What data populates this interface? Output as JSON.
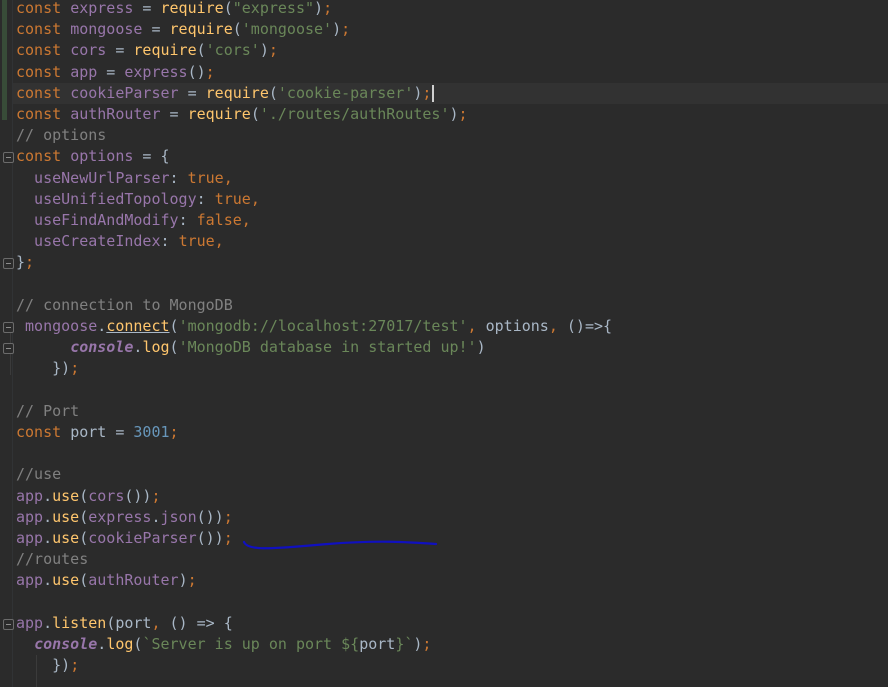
{
  "editor": {
    "lines": [
      [
        {
          "t": "const ",
          "c": "kw"
        },
        {
          "t": "express",
          "c": "id"
        },
        {
          "t": " = ",
          "c": "pl"
        },
        {
          "t": "require",
          "c": "fn"
        },
        {
          "t": "(",
          "c": "pl"
        },
        {
          "t": "\"express\"",
          "c": "str"
        },
        {
          "t": ")",
          "c": "pl"
        },
        {
          "t": ";",
          "c": "kw"
        }
      ],
      [
        {
          "t": "const ",
          "c": "kw"
        },
        {
          "t": "mongoose",
          "c": "id"
        },
        {
          "t": " = ",
          "c": "pl"
        },
        {
          "t": "require",
          "c": "fn"
        },
        {
          "t": "(",
          "c": "pl"
        },
        {
          "t": "'mongoose'",
          "c": "str"
        },
        {
          "t": ")",
          "c": "pl"
        },
        {
          "t": ";",
          "c": "kw"
        }
      ],
      [
        {
          "t": "const ",
          "c": "kw"
        },
        {
          "t": "cors",
          "c": "id"
        },
        {
          "t": " = ",
          "c": "pl"
        },
        {
          "t": "require",
          "c": "fn"
        },
        {
          "t": "(",
          "c": "pl"
        },
        {
          "t": "'cors'",
          "c": "str"
        },
        {
          "t": ")",
          "c": "pl"
        },
        {
          "t": ";",
          "c": "kw"
        }
      ],
      [
        {
          "t": "const ",
          "c": "kw"
        },
        {
          "t": "app",
          "c": "id"
        },
        {
          "t": " = ",
          "c": "pl"
        },
        {
          "t": "express",
          "c": "id"
        },
        {
          "t": "()",
          "c": "pl"
        },
        {
          "t": ";",
          "c": "kw"
        }
      ],
      [
        {
          "t": "const ",
          "c": "kw"
        },
        {
          "t": "cookieParser",
          "c": "id"
        },
        {
          "t": " = ",
          "c": "pl"
        },
        {
          "t": "require",
          "c": "fn"
        },
        {
          "t": "(",
          "c": "pl"
        },
        {
          "t": "'cookie-parser'",
          "c": "str"
        },
        {
          "t": ")",
          "c": "pl"
        },
        {
          "t": ";",
          "c": "kw"
        }
      ],
      [
        {
          "t": "const ",
          "c": "kw"
        },
        {
          "t": "authRouter",
          "c": "id"
        },
        {
          "t": " = ",
          "c": "pl"
        },
        {
          "t": "require",
          "c": "fn"
        },
        {
          "t": "(",
          "c": "pl"
        },
        {
          "t": "'./routes/authRoutes'",
          "c": "str"
        },
        {
          "t": ")",
          "c": "pl"
        },
        {
          "t": ";",
          "c": "kw"
        }
      ],
      [
        {
          "t": "// options",
          "c": "cm"
        }
      ],
      [
        {
          "t": "const ",
          "c": "kw"
        },
        {
          "t": "options",
          "c": "id"
        },
        {
          "t": " = {",
          "c": "pl"
        }
      ],
      [
        {
          "t": "  useNewUrlParser",
          "c": "id"
        },
        {
          "t": ": ",
          "c": "pl"
        },
        {
          "t": "true",
          "c": "kw"
        },
        {
          "t": ",",
          "c": "kw"
        }
      ],
      [
        {
          "t": "  useUnifiedTopology",
          "c": "id"
        },
        {
          "t": ": ",
          "c": "pl"
        },
        {
          "t": "true",
          "c": "kw"
        },
        {
          "t": ",",
          "c": "kw"
        }
      ],
      [
        {
          "t": "  useFindAndModify",
          "c": "id"
        },
        {
          "t": ": ",
          "c": "pl"
        },
        {
          "t": "false",
          "c": "kw"
        },
        {
          "t": ",",
          "c": "kw"
        }
      ],
      [
        {
          "t": "  useCreateIndex",
          "c": "id"
        },
        {
          "t": ": ",
          "c": "pl"
        },
        {
          "t": "true",
          "c": "kw"
        },
        {
          "t": ",",
          "c": "kw"
        }
      ],
      [
        {
          "t": "}",
          "c": "pl"
        },
        {
          "t": ";",
          "c": "kw"
        }
      ],
      [],
      [
        {
          "t": "// connection to MongoDB",
          "c": "cm"
        }
      ],
      [
        {
          "t": " mongoose",
          "c": "id"
        },
        {
          "t": ".",
          "c": "pl"
        },
        {
          "t": "connect",
          "c": "fn und"
        },
        {
          "t": "(",
          "c": "pl"
        },
        {
          "t": "'mongodb://localhost:27017/test'",
          "c": "str"
        },
        {
          "t": ", ",
          "c": "kw"
        },
        {
          "t": "options",
          "c": "pl"
        },
        {
          "t": ", ",
          "c": "kw"
        },
        {
          "t": "()=>{",
          "c": "pl"
        }
      ],
      [
        {
          "t": "      ",
          "c": "pl"
        },
        {
          "t": "console",
          "c": "gl"
        },
        {
          "t": ".",
          "c": "pl"
        },
        {
          "t": "log",
          "c": "fn"
        },
        {
          "t": "(",
          "c": "pl"
        },
        {
          "t": "'MongoDB database in started up!'",
          "c": "str"
        },
        {
          "t": ")",
          "c": "pl"
        }
      ],
      [
        {
          "t": "    })",
          "c": "pl"
        },
        {
          "t": ";",
          "c": "kw"
        }
      ],
      [],
      [
        {
          "t": "// Port",
          "c": "cm"
        }
      ],
      [
        {
          "t": "const ",
          "c": "kw"
        },
        {
          "t": "port",
          "c": "pl"
        },
        {
          "t": " = ",
          "c": "pl"
        },
        {
          "t": "3001",
          "c": "num"
        },
        {
          "t": ";",
          "c": "kw"
        }
      ],
      [],
      [
        {
          "t": "//use",
          "c": "cm"
        }
      ],
      [
        {
          "t": "app",
          "c": "id"
        },
        {
          "t": ".",
          "c": "pl"
        },
        {
          "t": "use",
          "c": "fn"
        },
        {
          "t": "(",
          "c": "pl"
        },
        {
          "t": "cors",
          "c": "id"
        },
        {
          "t": "())",
          "c": "pl"
        },
        {
          "t": ";",
          "c": "kw"
        }
      ],
      [
        {
          "t": "app",
          "c": "id"
        },
        {
          "t": ".",
          "c": "pl"
        },
        {
          "t": "use",
          "c": "fn"
        },
        {
          "t": "(",
          "c": "pl"
        },
        {
          "t": "express",
          "c": "id"
        },
        {
          "t": ".",
          "c": "pl"
        },
        {
          "t": "json",
          "c": "id"
        },
        {
          "t": "())",
          "c": "pl"
        },
        {
          "t": ";",
          "c": "kw"
        }
      ],
      [
        {
          "t": "app",
          "c": "id"
        },
        {
          "t": ".",
          "c": "pl"
        },
        {
          "t": "use",
          "c": "fn"
        },
        {
          "t": "(",
          "c": "pl"
        },
        {
          "t": "cookieParser",
          "c": "id"
        },
        {
          "t": "())",
          "c": "pl"
        },
        {
          "t": ";",
          "c": "kw"
        }
      ],
      [
        {
          "t": "//routes",
          "c": "cm"
        }
      ],
      [
        {
          "t": "app",
          "c": "id"
        },
        {
          "t": ".",
          "c": "pl"
        },
        {
          "t": "use",
          "c": "fn"
        },
        {
          "t": "(",
          "c": "pl"
        },
        {
          "t": "authRouter",
          "c": "id"
        },
        {
          "t": ")",
          "c": "pl"
        },
        {
          "t": ";",
          "c": "kw"
        }
      ],
      [],
      [
        {
          "t": "app",
          "c": "id"
        },
        {
          "t": ".",
          "c": "pl"
        },
        {
          "t": "listen",
          "c": "fn"
        },
        {
          "t": "(",
          "c": "pl"
        },
        {
          "t": "port",
          "c": "pl"
        },
        {
          "t": ", ",
          "c": "kw"
        },
        {
          "t": "() => {",
          "c": "pl"
        }
      ],
      [
        {
          "t": "  ",
          "c": "pl"
        },
        {
          "t": "console",
          "c": "gl"
        },
        {
          "t": ".",
          "c": "pl"
        },
        {
          "t": "log",
          "c": "fn"
        },
        {
          "t": "(",
          "c": "pl"
        },
        {
          "t": "`Server is up on port ${",
          "c": "str"
        },
        {
          "t": "port",
          "c": "pl"
        },
        {
          "t": "}`",
          "c": "str"
        },
        {
          "t": ")",
          "c": "pl"
        },
        {
          "t": ";",
          "c": "kw"
        }
      ],
      [
        {
          "t": "    })",
          "c": "pl"
        },
        {
          "t": ";",
          "c": "kw"
        }
      ]
    ]
  },
  "colors": {
    "background": "#2b2b2b",
    "keyword": "#cc7832",
    "identifier": "#9876aa",
    "function": "#ffc66d",
    "string": "#6a8759",
    "number": "#6897bb",
    "comment": "#808080",
    "annotation_stroke": "#1010c0"
  },
  "icons": [
    "fold-icon",
    "caret-icon"
  ]
}
